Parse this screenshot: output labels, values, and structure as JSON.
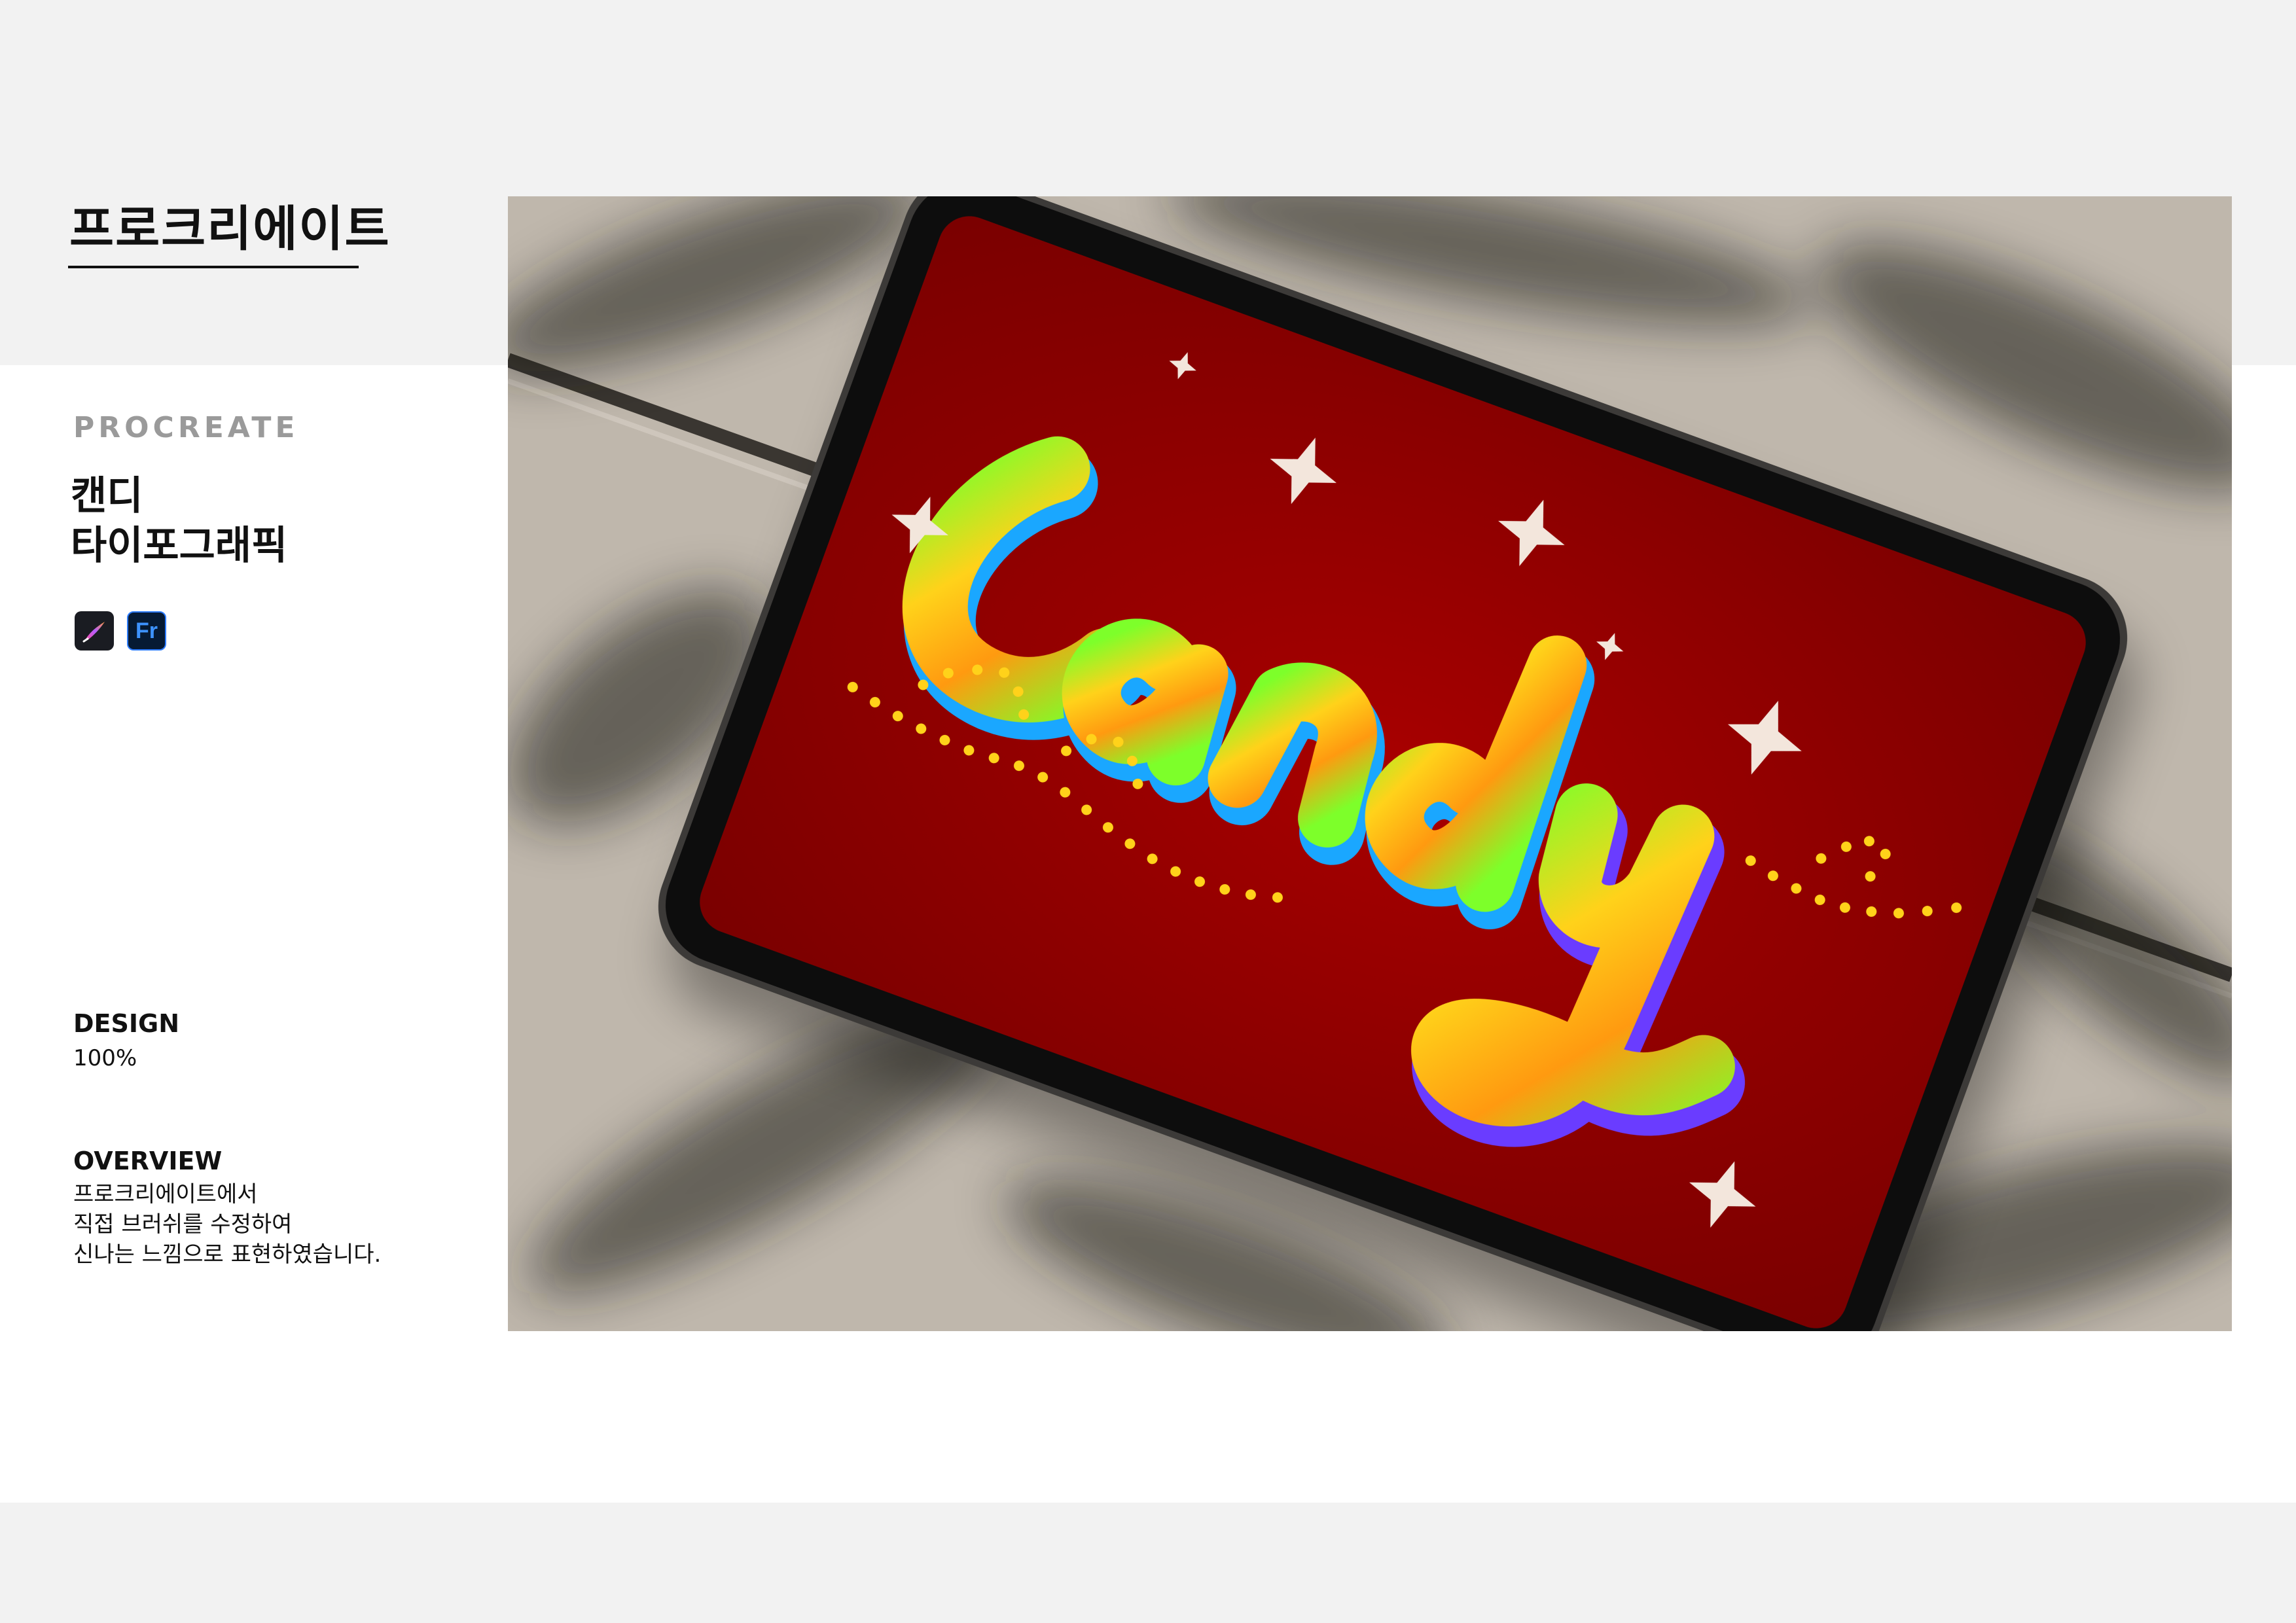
{
  "header": {
    "title": "프로크리에이트"
  },
  "project": {
    "eyebrow": "PROCREATE",
    "title_lines": [
      "캔디",
      "타이포그래픽"
    ],
    "tools": [
      {
        "name": "procreate-icon",
        "label": ""
      },
      {
        "name": "fresco-icon",
        "label": "Fr"
      }
    ]
  },
  "design": {
    "label": "DESIGN",
    "value": "100%"
  },
  "overview": {
    "label": "OVERVIEW",
    "lines": [
      "프로크리에이트에서",
      "직접 브러쉬를 수정하여",
      "신나는 느낌으로 표현하였습니다."
    ]
  },
  "artwork": {
    "lettering": "candy"
  },
  "colors": {
    "band": "#f2f2f2",
    "screen": "#a10000",
    "eyebrow": "#9a9a9a",
    "fresco_blue": "#2d7cff"
  }
}
